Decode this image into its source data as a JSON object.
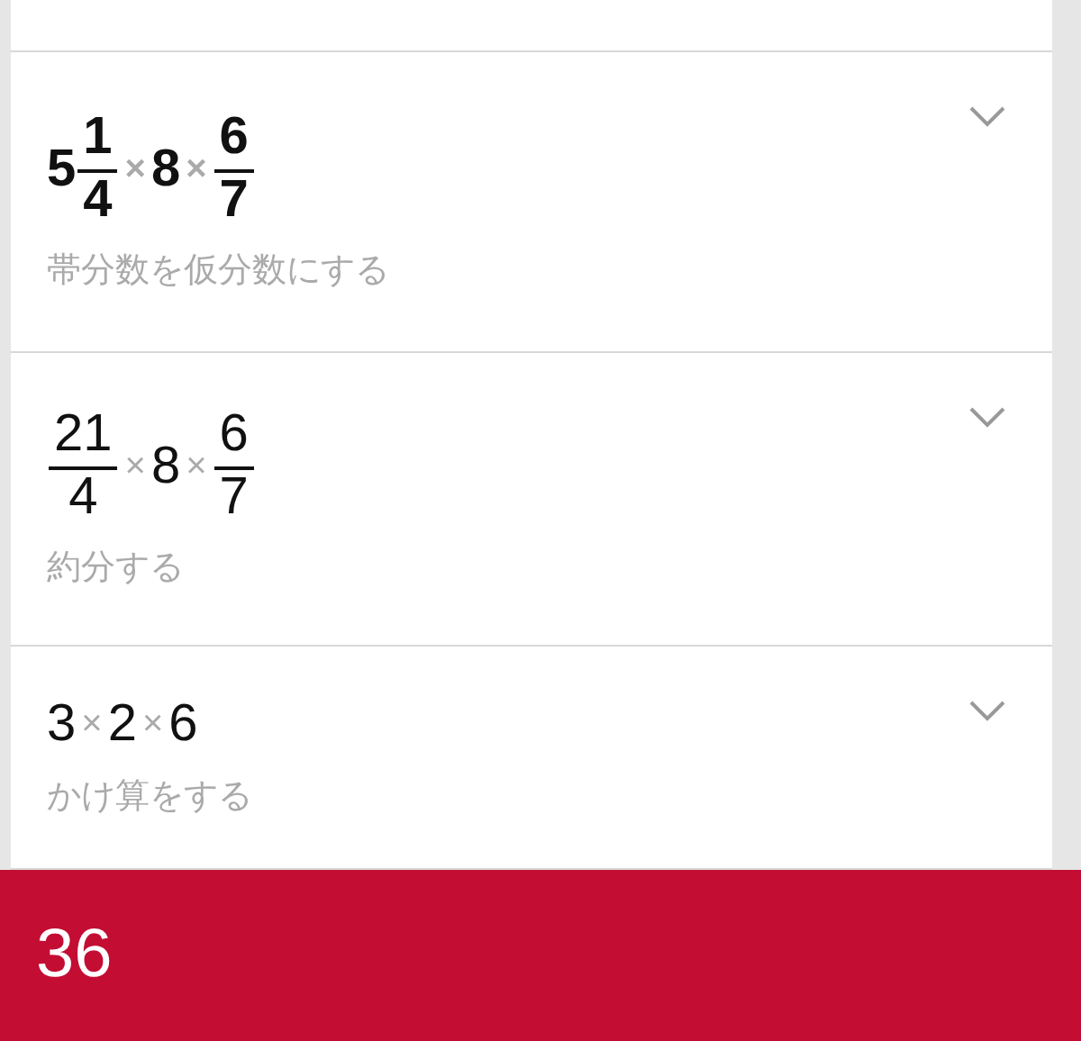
{
  "steps": [
    {
      "bold": true,
      "expanded": false,
      "expression": [
        {
          "kind": "mixed",
          "whole": "5",
          "num": "1",
          "den": "4"
        },
        {
          "kind": "op",
          "text": "×"
        },
        {
          "kind": "num",
          "text": "8"
        },
        {
          "kind": "op",
          "text": "×"
        },
        {
          "kind": "frac",
          "num": "6",
          "den": "7"
        }
      ],
      "caption": "帯分数を仮分数にする"
    },
    {
      "bold": false,
      "expanded": false,
      "expression": [
        {
          "kind": "frac",
          "num": "21",
          "den": "4"
        },
        {
          "kind": "op",
          "text": "×"
        },
        {
          "kind": "num",
          "text": "8"
        },
        {
          "kind": "op",
          "text": "×"
        },
        {
          "kind": "frac",
          "num": "6",
          "den": "7"
        }
      ],
      "caption": "約分する"
    },
    {
      "bold": false,
      "expanded": false,
      "expression": [
        {
          "kind": "num",
          "text": "3"
        },
        {
          "kind": "op",
          "text": "×"
        },
        {
          "kind": "num",
          "text": "2"
        },
        {
          "kind": "op",
          "text": "×"
        },
        {
          "kind": "num",
          "text": "6"
        }
      ],
      "caption": "かけ算をする"
    }
  ],
  "result": {
    "value": "36"
  }
}
